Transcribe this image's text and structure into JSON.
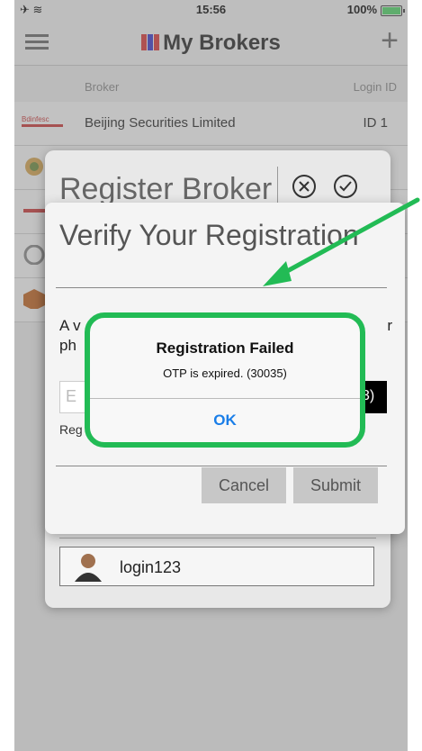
{
  "status_bar": {
    "time": "15:56",
    "battery": "100%",
    "airplane_glyph": "✈ ≋"
  },
  "navbar": {
    "title": "My Brokers",
    "add_glyph": "+"
  },
  "table": {
    "headers": [
      "Broker",
      "Login ID"
    ],
    "rows": [
      {
        "name": "Beijing Securities Limited",
        "login_id": "ID 1"
      }
    ]
  },
  "register_panel": {
    "title": "Register Broker",
    "login_value": "login123"
  },
  "verify_panel": {
    "title": "Verify Your Registration",
    "message_fragment_1": "A v",
    "message_fragment_2": "r",
    "message_fragment_3": "ph",
    "otp_fragment": "E",
    "resend_fragment": "3)",
    "small_fragment": "Reg",
    "cancel_label": "Cancel",
    "submit_label": "Submit"
  },
  "alert": {
    "title": "Registration Failed",
    "message": "OTP is expired. (30035)",
    "ok_label": "OK"
  },
  "colors": {
    "highlight": "#22bb55",
    "link_blue": "#1a7ee8"
  }
}
